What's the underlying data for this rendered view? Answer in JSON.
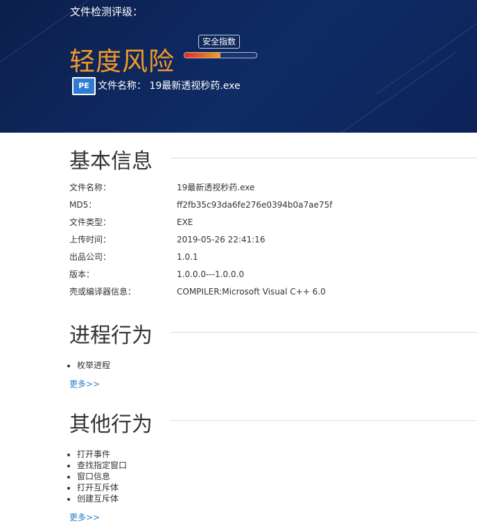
{
  "header": {
    "label": "文件检测评级：",
    "risk_level": "轻度风险",
    "gauge_label": "安全指数",
    "gauge_level_percent": 50,
    "file_icon_text": "PE",
    "file_name_label": "文件名称：",
    "file_name": "19最新透视秒药.exe"
  },
  "basic": {
    "title": "基本信息",
    "rows": [
      {
        "key": "文件名称：",
        "value": "19最新透视秒药.exe"
      },
      {
        "key": "MD5：",
        "value": "ff2fb35c93da6fe276e0394b0a7ae75f"
      },
      {
        "key": "文件类型：",
        "value": "EXE"
      },
      {
        "key": "上传时间：",
        "value": "2019-05-26 22:41:16"
      },
      {
        "key": "出品公司：",
        "value": "1.0.1"
      },
      {
        "key": "版本：",
        "value": "1.0.0.0---1.0.0.0"
      },
      {
        "key": "壳或编译器信息：",
        "value": "COMPILER:Microsoft Visual C++ 6.0"
      }
    ]
  },
  "process": {
    "title": "进程行为",
    "items": [
      "枚举进程"
    ],
    "more": "更多>>"
  },
  "other": {
    "title": "其他行为",
    "items": [
      "打开事件",
      "查找指定窗口",
      "窗口信息",
      "打开互斥体",
      "创建互斥体"
    ],
    "more": "更多>>"
  },
  "colors": {
    "header_bg": "#0f2c66",
    "risk": "#f39a2a",
    "link": "#2b7fc3"
  }
}
